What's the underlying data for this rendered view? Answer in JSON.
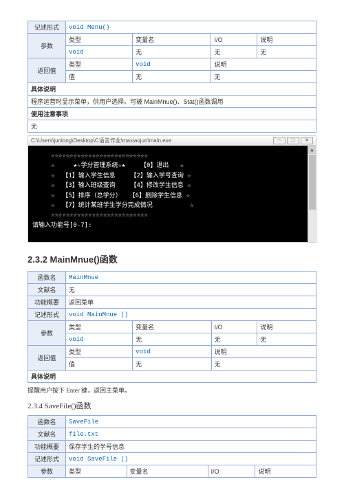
{
  "table1": {
    "row_jishu_label": "记述形式",
    "row_jishu_value": "void Menu()",
    "row_canshu_label": "参数",
    "hdr_type": "类型",
    "hdr_var": "变量名",
    "hdr_io": "I/O",
    "hdr_desc": "说明",
    "param_type": "void",
    "param_var": "无",
    "param_io": "无",
    "param_desc": "无",
    "row_return_label": "返回值",
    "ret_type_hdr": "类型",
    "ret_type_val": "void",
    "ret_desc_hdr": "说明",
    "ret_val_label": "值",
    "ret_val1": "无",
    "ret_val2": "无",
    "juti_label": "具体说明",
    "juti_text": "程序运营时显示菜单，供用户选择。可被 MainMnue()、Stat()函数调用",
    "caution_label": "使用注意事项",
    "caution_text": "无"
  },
  "console": {
    "title": "C:\\Users\\junlong\\Desktop\\C语言作业\\maxiaojun\\main.exe",
    "body": "     ☆☆☆☆☆☆☆☆☆☆☆☆☆☆☆☆☆☆☆☆☆☆☆☆☆☆\n     ☆     ★☆学分管理系统☆★    【0】退出   ☆\n     ☆  【1】输入学生信息    【2】输入学号查询 ☆\n     ☆  【3】输入班级查询    【4】修改学生信息 ☆\n     ☆  【5】排序（总学分）  【6】删除学生信息 ☆\n     ☆  【7】统计某班学生学分完成情况          ☆\n     ☆☆☆☆☆☆☆☆☆☆☆☆☆☆☆☆☆☆☆☆☆☆☆☆☆☆\n请输入功能号[0-7]:"
  },
  "section2_title": "2.3.2 MainMnue()函数",
  "table2": {
    "fn_label": "函数名",
    "fn_value": "MainMnue",
    "wx_label": "文献名",
    "wx_value": "无",
    "gn_label": "功能概要",
    "gn_value": "返回菜单",
    "js_label": "记述形式",
    "js_value": "void MainMnue ()",
    "cs_label": "参数",
    "hdr_type": "类型",
    "hdr_var": "变量名",
    "hdr_io": "I/O",
    "hdr_desc": "说明",
    "p_type": "void",
    "p_var": "无",
    "p_io": "无",
    "p_desc": "无",
    "ret_label": "返回值",
    "ret_type_hdr": "类型",
    "ret_type_val": "void",
    "ret_desc_hdr": "说明",
    "ret_val_label": "值",
    "ret_v1": "无",
    "ret_v2": "无",
    "jt_label": "具体说明"
  },
  "table2_desc": "提醒用户按下 Enter 键，返回主菜单。",
  "section3_title": "2.3.4 SaveFile()函数",
  "table3": {
    "fn_label": "函数名",
    "fn_value": "SaveFile",
    "wx_label": "文献名",
    "wx_value": "file.txt",
    "gn_label": "功能概要",
    "gn_value": "保存学生的学号信息",
    "js_label": "记述形式",
    "js_value": "void SaveFile ()",
    "cs_label": "参数",
    "hdr_type": "类型",
    "hdr_var": "变量名",
    "hdr_io": "I/O",
    "hdr_desc": "说明"
  }
}
